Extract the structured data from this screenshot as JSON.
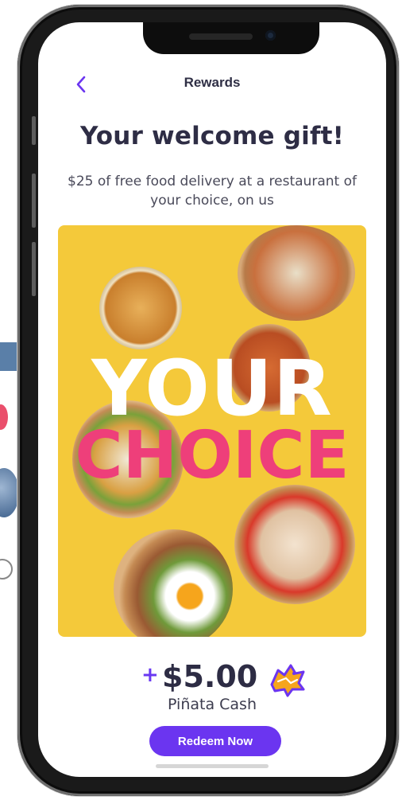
{
  "header": {
    "title": "Rewards"
  },
  "main": {
    "headline": "Your welcome gift!",
    "subtext": "$25 of free food delivery at a restaurant of your choice, on us",
    "promo": {
      "line1": "YOUR",
      "line2": "CHOICE"
    },
    "cash": {
      "plus": "+",
      "amount": "$5.00",
      "label": "Piñata Cash"
    },
    "redeem_label": "Redeem Now"
  },
  "colors": {
    "accent": "#6b35f0",
    "title_text": "#2e2d45",
    "promo_background": "#f4c93a",
    "promo_choice": "#ee3f7a"
  },
  "icons": {
    "back": "chevron-left-icon",
    "cash": "pinata-icon"
  }
}
